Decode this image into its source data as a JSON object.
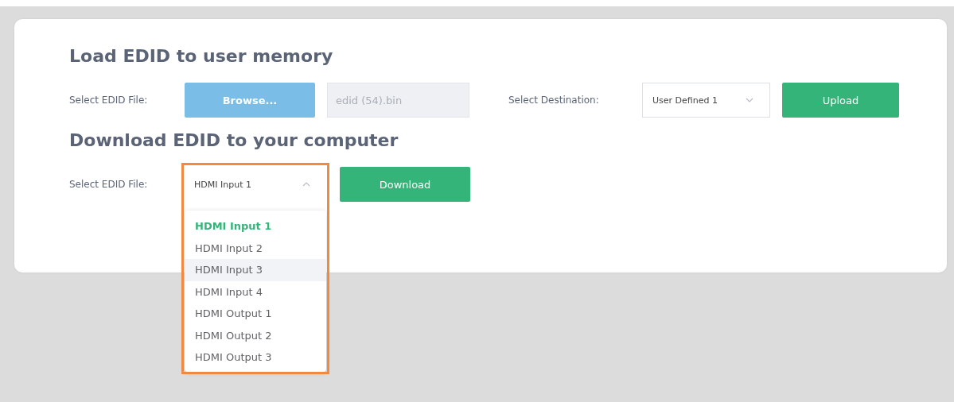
{
  "load_section": {
    "title": "Load EDID to user memory",
    "file_label": "Select EDID File:",
    "browse_button": "Browse...",
    "file_field": {
      "value": "edid (54).bin"
    },
    "destination_label": "Select Destination:",
    "destination_select": {
      "value": "User Defined 1",
      "expanded": false
    },
    "upload_button": "Upload"
  },
  "download_section": {
    "title": "Download EDID to your computer",
    "file_label": "Select EDID File:",
    "file_select": {
      "value": "HDMI Input 1",
      "expanded": true,
      "highlighted": true
    },
    "download_button": "Download",
    "options": [
      {
        "label": "HDMI Input 1",
        "selected": true,
        "hovered": false
      },
      {
        "label": "HDMI Input 2",
        "selected": false,
        "hovered": false
      },
      {
        "label": "HDMI Input 3",
        "selected": false,
        "hovered": true
      },
      {
        "label": "HDMI Input 4",
        "selected": false,
        "hovered": false
      },
      {
        "label": "HDMI Output 1",
        "selected": false,
        "hovered": false
      },
      {
        "label": "HDMI Output 2",
        "selected": false,
        "hovered": false
      },
      {
        "label": "HDMI Output 3",
        "selected": false,
        "hovered": false
      }
    ]
  }
}
